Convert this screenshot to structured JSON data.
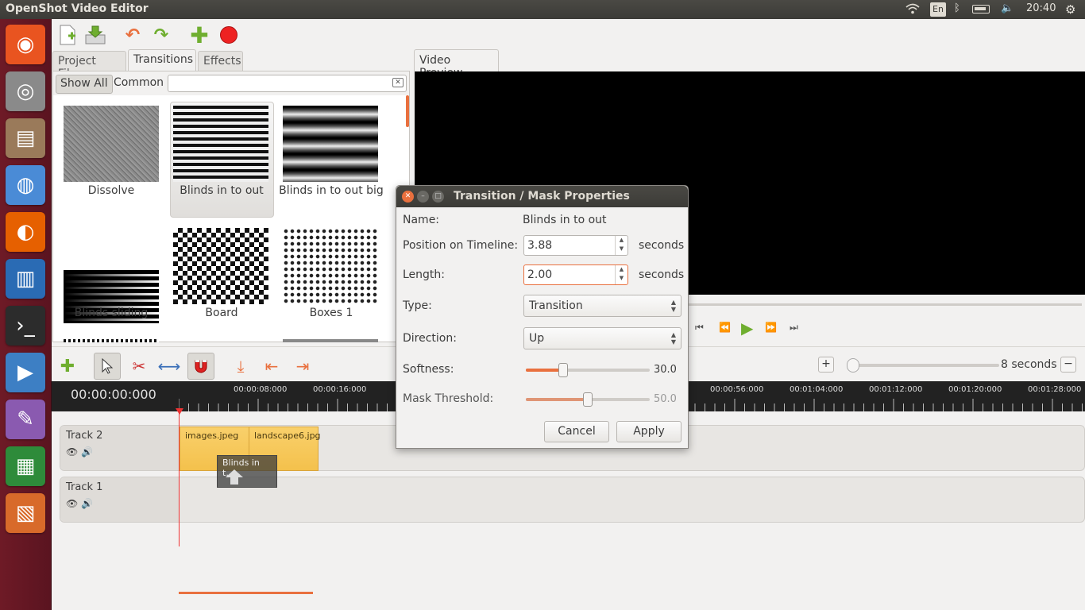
{
  "topbar": {
    "app_title": "OpenShot Video Editor",
    "keyboard": "En",
    "clock": "20:40",
    "wifi_icon": "wifi-icon",
    "bluetooth_icon": "bluetooth-icon",
    "battery_icon": "battery-icon",
    "volume_icon": "volume-icon",
    "settings_icon": "gear-icon"
  },
  "launcher": [
    {
      "name": "ubuntu-dash-icon",
      "color": "#e95420",
      "glyph": "◉"
    },
    {
      "name": "camera-icon",
      "color": "#8a8a8a",
      "glyph": "◎"
    },
    {
      "name": "file-manager-icon",
      "color": "#9a7a5a",
      "glyph": "▤"
    },
    {
      "name": "chrome-icon",
      "color": "#4a8bd6",
      "glyph": "◍"
    },
    {
      "name": "firefox-icon",
      "color": "#e66000",
      "glyph": "◐"
    },
    {
      "name": "writer-icon",
      "color": "#2a6bb4",
      "glyph": "▥"
    },
    {
      "name": "terminal-icon",
      "color": "#2c2c2c",
      "glyph": "›_"
    },
    {
      "name": "video-player-icon",
      "color": "#3d7fc4",
      "glyph": "▶"
    },
    {
      "name": "paint-icon",
      "color": "#8a5ab0",
      "glyph": "✎"
    },
    {
      "name": "spreadsheet-icon",
      "color": "#2e8b3a",
      "glyph": "▦"
    },
    {
      "name": "impress-icon",
      "color": "#d86a2a",
      "glyph": "▧"
    }
  ],
  "toolbar": {
    "new_icon": "new-project-icon",
    "open_icon": "open-project-icon",
    "undo_icon": "undo-icon",
    "redo_icon": "redo-icon",
    "add_icon": "add-icon",
    "record_icon": "record-icon"
  },
  "tabs": [
    "Project Files",
    "Transitions",
    "Effects"
  ],
  "filter": {
    "show_all": "Show All",
    "common": "Common",
    "search_value": ""
  },
  "transitions": [
    {
      "label": "Dissolve"
    },
    {
      "label": "Blinds in to out"
    },
    {
      "label": "Blinds in to out big"
    },
    {
      "label": "Blinds sliding"
    },
    {
      "label": "Board"
    },
    {
      "label": "Boxes 1"
    }
  ],
  "preview": {
    "tab": "Video Preview"
  },
  "timeline": {
    "timecode": "00:00:00:000",
    "zoom_label": "8 seconds",
    "zoom_value": 0.04,
    "ticks_left": [
      "00:00:08:000",
      "00:00:16:000"
    ],
    "ticks_right": [
      "00:00:56:000",
      "00:01:04:000",
      "00:01:12:000",
      "00:01:20:000",
      "00:01:28:000"
    ],
    "tracks": [
      {
        "name": "Track 2"
      },
      {
        "name": "Track 1"
      }
    ],
    "clips": [
      "images.jpeg",
      "landscape6.jpg"
    ],
    "transition_clip": "Blinds in t..."
  },
  "dialog": {
    "title": "Transition / Mask Properties",
    "name_label": "Name:",
    "name_value": "Blinds in to out",
    "position_label": "Position on Timeline:",
    "position_value": "3.88",
    "length_label": "Length:",
    "length_value": "2.00",
    "unit": "seconds",
    "type_label": "Type:",
    "type_value": "Transition",
    "direction_label": "Direction:",
    "direction_value": "Up",
    "softness_label": "Softness:",
    "softness_value": "30.0",
    "softness_fraction": 0.3,
    "mask_label": "Mask Threshold:",
    "mask_value": "50.0",
    "mask_fraction": 0.5,
    "cancel": "Cancel",
    "apply": "Apply"
  },
  "colors": {
    "accent": "#e9703e",
    "clip": "#f4c14c",
    "launcher": "#6e1a26"
  }
}
